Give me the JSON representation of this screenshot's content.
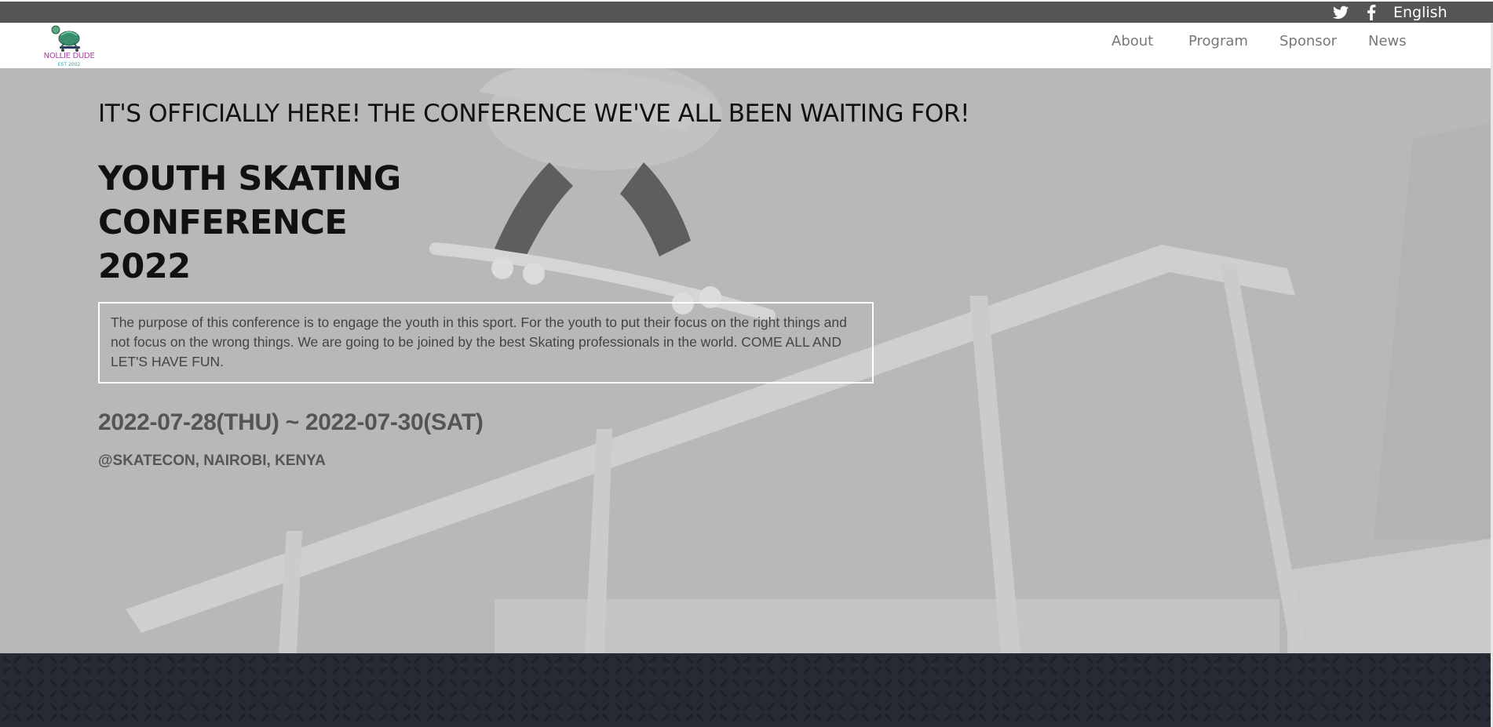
{
  "topbar": {
    "twitter_icon": "twitter-icon",
    "facebook_icon": "facebook-icon",
    "language": "English"
  },
  "brand": {
    "name": "NOLLIE DUDE",
    "est": "EST 2002"
  },
  "nav": {
    "items": [
      {
        "label": "About"
      },
      {
        "label": "Program"
      },
      {
        "label": "Sponsor"
      },
      {
        "label": "News"
      }
    ]
  },
  "hero": {
    "tagline": "IT'S OFFICIALLY HERE! THE CONFERENCE WE'VE ALL BEEN WAITING FOR!",
    "title_lines": [
      "YOUTH SKATING",
      "CONFERENCE",
      "2022"
    ],
    "description": "The purpose of this conference is to engage the youth in this sport. For the youth to put their focus on the right things and not focus on the wrong things. We are going to be joined by the best Skating professionals in the world. COME ALL AND LET'S HAVE FUN.",
    "dates": "2022-07-28(THU) ~ 2022-07-30(SAT)",
    "venue": "@SKATECON, NAIROBI, KENYA"
  },
  "colors": {
    "topbar": "#555555",
    "hero_overlay": "#b7b7b7",
    "footer": "#262a33",
    "logo_pink": "#b23aa6",
    "logo_teal": "#2aa9a0"
  }
}
